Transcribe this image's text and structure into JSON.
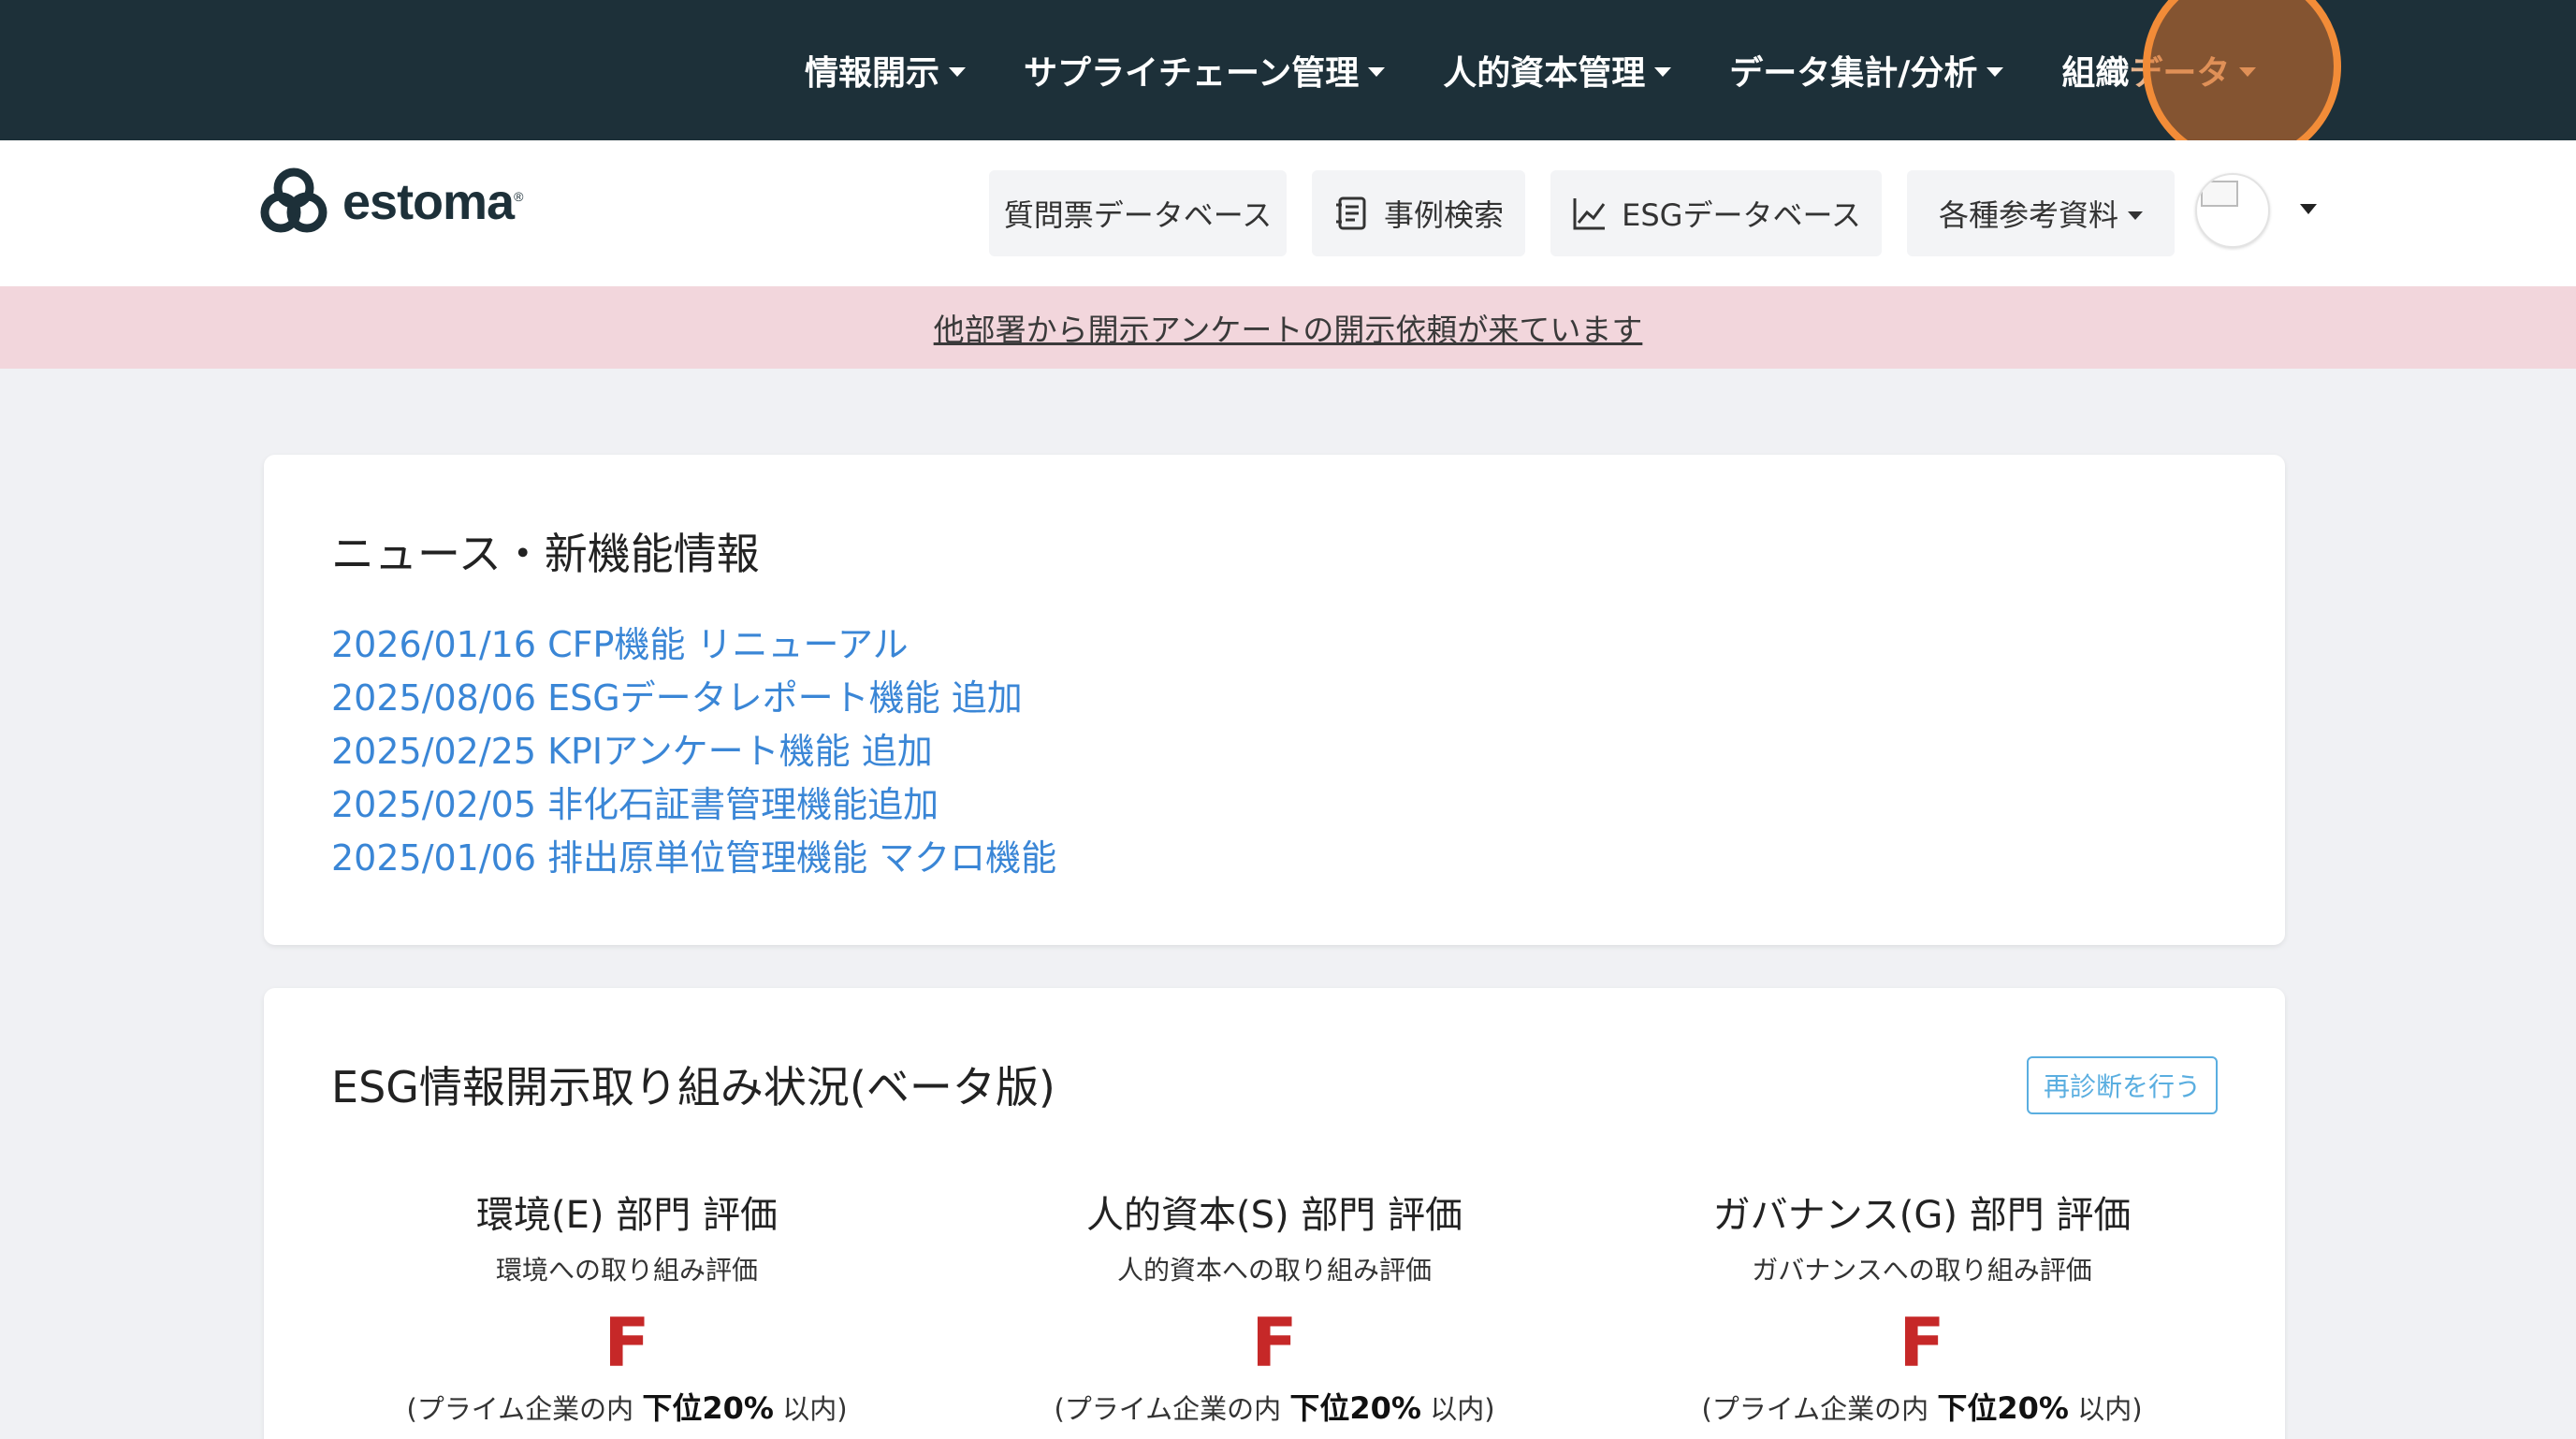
{
  "topnav": {
    "items": [
      {
        "label": "情報開示"
      },
      {
        "label": "サプライチェーン管理"
      },
      {
        "label": "人的資本管理"
      },
      {
        "label": "データ集計/分析"
      },
      {
        "label_a": "組織",
        "label_b": "データ"
      }
    ]
  },
  "header": {
    "logo_text": "estoma",
    "logo_mark": "®",
    "buttons": {
      "questionnaire_db": "質問票データベース",
      "case_search": "事例検索",
      "esg_db": "ESGデータベース",
      "references": "各種参考資料"
    }
  },
  "alert": {
    "text": "他部署から開示アンケートの開示依頼が来ています"
  },
  "news": {
    "title": "ニュース・新機能情報",
    "items": [
      "2026/01/16 CFP機能 リニューアル",
      "2025/08/06 ESGデータレポート機能 追加",
      "2025/02/25 KPIアンケート機能 追加",
      "2025/02/05 非化石証書管理機能追加",
      "2025/01/06 排出原単位管理機能 マクロ機能"
    ]
  },
  "esg": {
    "title": "ESG情報開示取り組み状況(ベータ版)",
    "rediag_label": "再診断を行う",
    "columns": [
      {
        "title": "環境(E) 部門 評価",
        "subtitle": "環境への取り組み評価",
        "grade": "F",
        "rank_pre": "(プライム企業の内",
        "rank_bold": "下位20%",
        "rank_post": "以内)"
      },
      {
        "title": "人的資本(S) 部門 評価",
        "subtitle": "人的資本への取り組み評価",
        "grade": "F",
        "rank_pre": "(プライム企業の内",
        "rank_bold": "下位20%",
        "rank_post": "以内)"
      },
      {
        "title": "ガバナンス(G) 部門 評価",
        "subtitle": "ガバナンスへの取り組み評価",
        "grade": "F",
        "rank_pre": "(プライム企業の内",
        "rank_bold": "下位20%",
        "rank_post": "以内)"
      }
    ]
  },
  "colors": {
    "topnav_bg": "#1d3039",
    "alert_bg": "#f2d6dc",
    "link": "#3a86d6",
    "grade_red": "#c62828",
    "click_highlight": "#f28c38"
  }
}
